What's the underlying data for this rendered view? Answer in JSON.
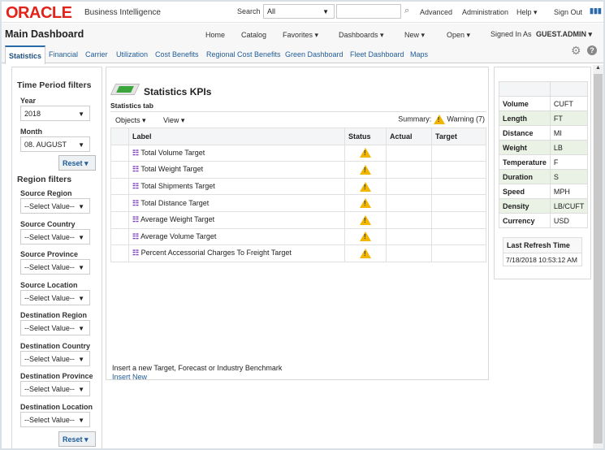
{
  "header": {
    "brand": "ORACLE",
    "product": "Business Intelligence",
    "search_label": "Search",
    "search_scope": "All",
    "search_value": "",
    "links": [
      "Advanced",
      "Administration",
      "Help ▾",
      "Sign Out"
    ]
  },
  "nav": {
    "title": "Main Dashboard",
    "items": [
      "Home",
      "Catalog",
      "Favorites ▾",
      "Dashboards ▾",
      "New ▾",
      "Open ▾"
    ],
    "signed_in_label": "Signed In As",
    "user": "GUEST.ADMIN ▾"
  },
  "tabs": [
    "Statistics",
    "Financial",
    "Carrier",
    "Utilization",
    "Cost Benefits",
    "Regional Cost Benefits",
    "Green Dashboard",
    "Fleet Dashboard",
    "Maps"
  ],
  "filters": {
    "time_heading": "Time Period filters",
    "year_label": "Year",
    "year_value": "2018",
    "month_label": "Month",
    "month_value": "08. AUGUST",
    "reset": "Reset",
    "region_heading": "Region filters",
    "region_fields": [
      {
        "label": "Source Region",
        "value": "--Select Value--"
      },
      {
        "label": "Source Country",
        "value": "--Select Value--"
      },
      {
        "label": "Source Province",
        "value": "--Select Value--"
      },
      {
        "label": "Source Location",
        "value": "--Select Value--"
      },
      {
        "label": "Destination Region",
        "value": "--Select Value--"
      },
      {
        "label": "Destination Country",
        "value": "--Select Value--"
      },
      {
        "label": "Destination Province",
        "value": "--Select Value--"
      },
      {
        "label": "Destination Location",
        "value": "--Select Value--"
      }
    ]
  },
  "kpi": {
    "title": "Statistics KPIs",
    "subtitle": "Statistics tab",
    "objects": "Objects ▾",
    "view": "View ▾",
    "summary_label": "Summary:",
    "summary_value": "Warning (7)",
    "columns": [
      "Label",
      "Status",
      "Actual",
      "Target"
    ],
    "rows": [
      {
        "label": "Total Volume Target",
        "status": "warning"
      },
      {
        "label": "Total Weight Target",
        "status": "warning"
      },
      {
        "label": "Total Shipments Target",
        "status": "warning"
      },
      {
        "label": "Total Distance Target",
        "status": "warning"
      },
      {
        "label": "Average Weight Target",
        "status": "warning"
      },
      {
        "label": "Average Volume Target",
        "status": "warning"
      },
      {
        "label": "Percent Accessorial Charges To Freight Target",
        "status": "warning"
      }
    ],
    "insert_text": "Insert a new Target, Forecast or Industry Benchmark",
    "insert_link": "Insert New"
  },
  "units": [
    [
      "Volume",
      "CUFT"
    ],
    [
      "Length",
      "FT"
    ],
    [
      "Distance",
      "MI"
    ],
    [
      "Weight",
      "LB"
    ],
    [
      "Temperature",
      "F"
    ],
    [
      "Duration",
      "S"
    ],
    [
      "Speed",
      "MPH"
    ],
    [
      "Density",
      "LB/CUFT"
    ],
    [
      "Currency",
      "USD"
    ]
  ],
  "refresh": {
    "label": "Last Refresh Time",
    "value": "7/18/2018 10:53:12 AM"
  },
  "colors": {
    "brand": "#e2231a",
    "link": "#1f5c99",
    "warning": "#f2b600",
    "kpi_icon": "#7b3fb5"
  }
}
